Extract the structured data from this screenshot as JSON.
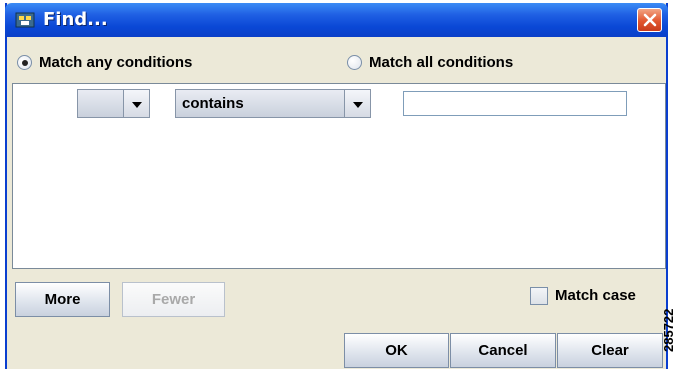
{
  "window": {
    "title": "Find..."
  },
  "match": {
    "any_label": "Match any conditions",
    "all_label": "Match all conditions",
    "selected": "any"
  },
  "condition": {
    "field_value": "",
    "operator_value": "contains",
    "text_value": ""
  },
  "buttons": {
    "more": "More",
    "fewer": "Fewer",
    "ok": "OK",
    "cancel": "Cancel",
    "clear": "Clear"
  },
  "match_case": {
    "label": "Match case",
    "checked": false
  },
  "figure_id": "285722",
  "colors": {
    "titlebar": "#0a48d6",
    "window_bg": "#ece9d8",
    "close_button": "#e2562f"
  }
}
